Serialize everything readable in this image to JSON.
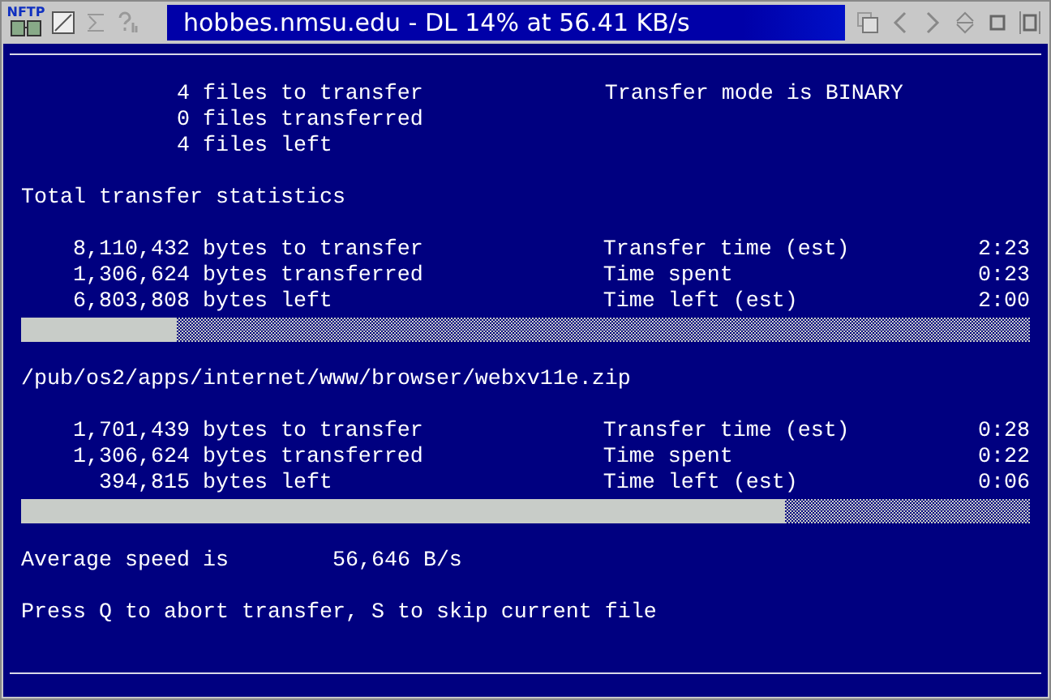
{
  "window": {
    "logo": "NFTP",
    "title": "hobbes.nmsu.edu - DL 14% at 56.41 KB/s"
  },
  "summary": {
    "rows": [
      {
        "count": "4",
        "label": "files to transfer"
      },
      {
        "count": "0",
        "label": "files transferred"
      },
      {
        "count": "4",
        "label": "files left"
      }
    ],
    "mode": "Transfer mode is BINARY"
  },
  "total": {
    "title": "Total transfer statistics",
    "rows": [
      {
        "amount": "8,110,432",
        "amount_text": "bytes to transfer",
        "stat_label": "Transfer time (est)",
        "stat_value": "2:23"
      },
      {
        "amount": "1,306,624",
        "amount_text": "bytes transferred",
        "stat_label": "Time spent",
        "stat_value": "0:23"
      },
      {
        "amount": "6,803,808",
        "amount_text": "bytes left",
        "stat_label": "Time left (est)",
        "stat_value": "2:00"
      }
    ],
    "level": 0.154
  },
  "file": {
    "path": "/pub/os2/apps/internet/www/browser/webxv11e.zip",
    "rows": [
      {
        "amount": "1,701,439",
        "amount_text": "bytes to transfer",
        "stat_label": "Transfer time (est)",
        "stat_value": "0:28"
      },
      {
        "amount": "1,306,624",
        "amount_text": "bytes transferred",
        "stat_label": "Time spent",
        "stat_value": "0:22"
      },
      {
        "amount": "394,815",
        "amount_text": "bytes left",
        "stat_label": "Time left (est)",
        "stat_value": "0:06"
      }
    ],
    "level": 0.757
  },
  "speed": {
    "label": "Average speed is",
    "value": "56,646 B/s"
  },
  "hint": "Press Q to abort transfer, S to skip current file"
}
